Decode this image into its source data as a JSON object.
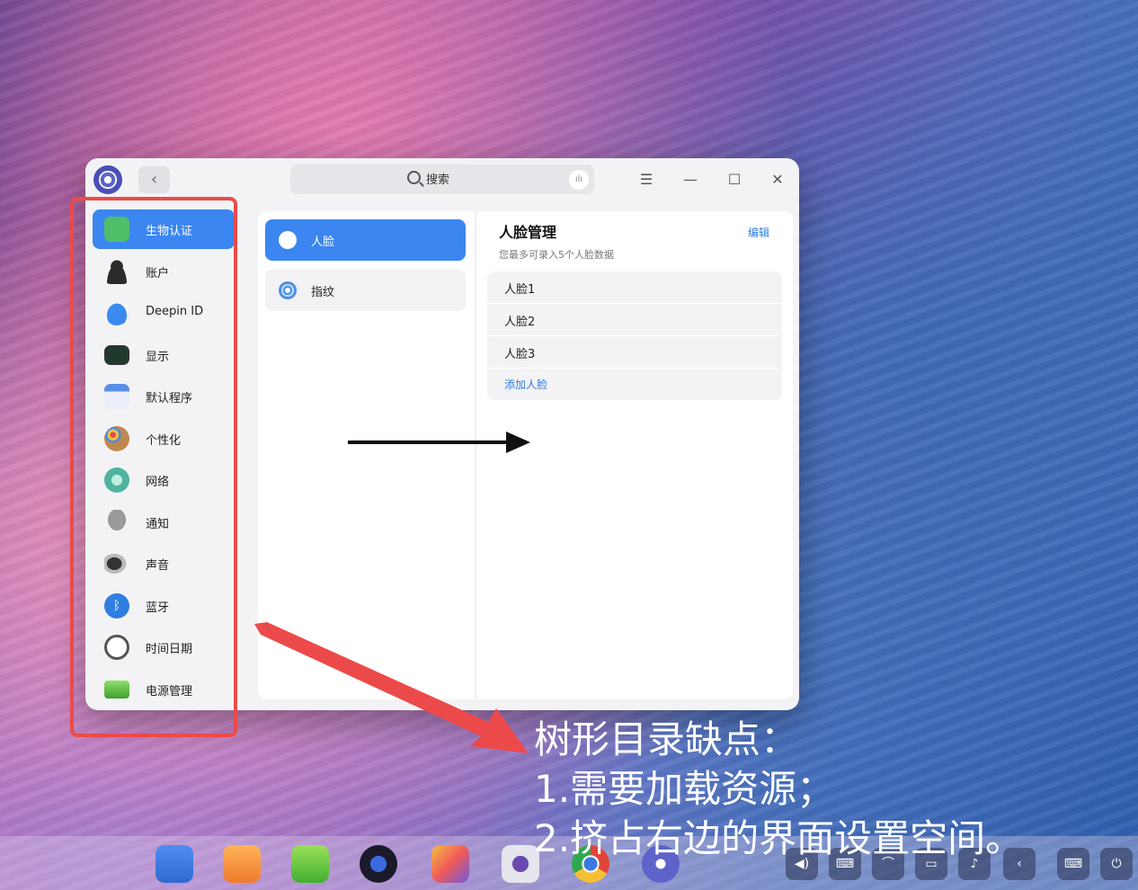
{
  "window": {
    "search_placeholder": "搜索",
    "voice_icon": "mic-wave-icon",
    "menu_icon": "☰",
    "minimize_icon": "—",
    "maximize_icon": "☐",
    "close_icon": "✕",
    "back_icon": "‹"
  },
  "sidebar": {
    "items": [
      {
        "label": "生物认证",
        "icon": "fingerprint-face-icon",
        "color": "#4fbf6a"
      },
      {
        "label": "账户",
        "icon": "user-icon",
        "color": "#2a2a2a"
      },
      {
        "label": "Deepin ID",
        "icon": "cloud-icon",
        "color": "#3a8af0"
      },
      {
        "label": "显示",
        "icon": "monitor-icon",
        "color": "#2a3a3a"
      },
      {
        "label": "默认程序",
        "icon": "window-icon",
        "color": "#5a8ee6"
      },
      {
        "label": "个性化",
        "icon": "palette-icon",
        "color": "#b0743a"
      },
      {
        "label": "网络",
        "icon": "globe-icon",
        "color": "#4fb3a0"
      },
      {
        "label": "通知",
        "icon": "bell-icon",
        "color": "#8a8a8a"
      },
      {
        "label": "声音",
        "icon": "speaker-icon",
        "color": "#555555"
      },
      {
        "label": "蓝牙",
        "icon": "bluetooth-icon",
        "color": "#2f7de0"
      },
      {
        "label": "时间日期",
        "icon": "clock-icon",
        "color": "#888888"
      },
      {
        "label": "电源管理",
        "icon": "battery-icon",
        "color": "#57c043"
      }
    ]
  },
  "middle": {
    "items": [
      {
        "label": "人脸",
        "icon": "face-icon"
      },
      {
        "label": "指纹",
        "icon": "fingerprint-icon"
      }
    ]
  },
  "detail": {
    "title": "人脸管理",
    "edit_label": "编辑",
    "subtitle": "您最多可录入5个人脸数据",
    "faces": [
      "人脸1",
      "人脸2",
      "人脸3"
    ],
    "add_label": "添加人脸"
  },
  "annotation": {
    "line1": "树形目录缺点：",
    "line2": "1.需要加载资源；",
    "line3": "2.挤占右边的界面设置空间。"
  },
  "dock": {
    "apps": [
      "file-manager-icon",
      "app-store-icon",
      "music-icon",
      "video-player-icon",
      "photos-icon",
      "camera-icon",
      "chrome-icon",
      "control-center-icon"
    ],
    "tray": [
      "volume-icon",
      "keyboard-icon",
      "wifi-icon",
      "battery-icon",
      "notification-icon",
      "chevron-left-icon",
      "onscreen-keyboard-icon",
      "power-icon"
    ]
  },
  "colors": {
    "accent": "#3b86f0",
    "annotation_red": "#ec4a4a"
  }
}
